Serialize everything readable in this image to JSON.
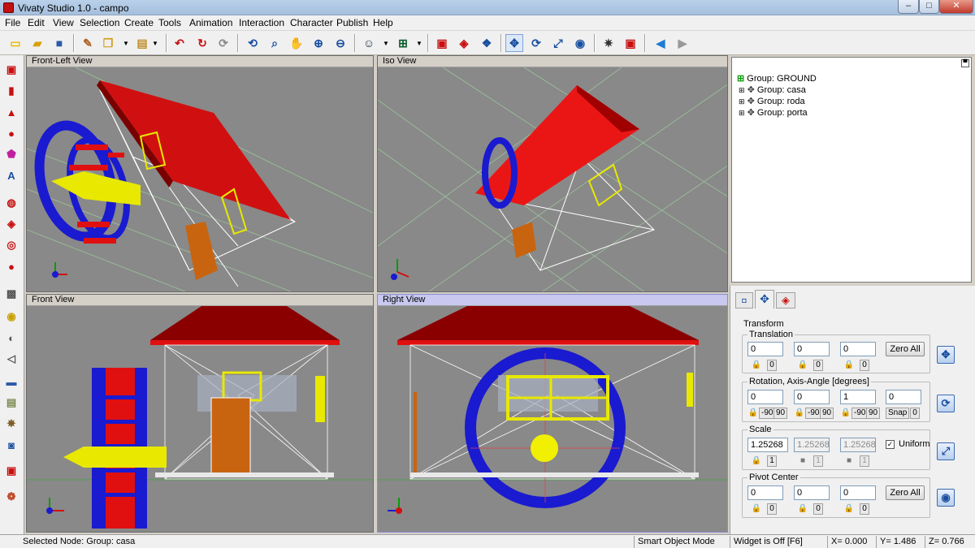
{
  "window": {
    "title": "Vivaty Studio 1.0 - campo",
    "min": "–",
    "max": "□",
    "close": "✕"
  },
  "menu": [
    "File",
    "Edit",
    "View",
    "Selection",
    "Create",
    "Tools",
    "Animation",
    "Interaction",
    "Character",
    "Publish",
    "Help"
  ],
  "toolbar_icons": [
    "new-icon",
    "open-icon",
    "save-icon",
    "paint-icon",
    "paste-icon",
    "clipboard-icon",
    "undo-icon",
    "redo-icon",
    "repeat-icon",
    "orbit-icon",
    "zoom-icon",
    "pan-hand-icon",
    "zoom-in-icon",
    "zoom-out-icon",
    "avatar-icon",
    "layout-icon",
    "box-icon",
    "material-icon",
    "cubes-icon",
    "move-icon",
    "rotate-icon",
    "scale-icon",
    "center-icon",
    "light-icon",
    "texture-icon",
    "back-arrow-icon",
    "forward-arrow-icon"
  ],
  "viewports": {
    "front_left": "Front-Left View",
    "iso": "Iso View",
    "front": "Front View",
    "right": "Right View"
  },
  "tree": {
    "root": "Group:  GROUND",
    "children": [
      "Group:  casa",
      "Group:  roda",
      "Group:  porta"
    ]
  },
  "props": {
    "tabs": [
      "node-tab",
      "transform-tab",
      "material-tab"
    ],
    "section": "Transform",
    "translation": {
      "label": "Translation",
      "values": [
        "0",
        "0",
        "0"
      ],
      "snap": [
        "0",
        "0",
        "0"
      ],
      "zero": "Zero All"
    },
    "rotation": {
      "label": "Rotation, Axis-Angle  [degrees]",
      "values": [
        "0",
        "0",
        "1",
        "0"
      ],
      "snap": [
        "-90",
        "90"
      ],
      "snap_label": "Snap",
      "snap_value": "0"
    },
    "scale": {
      "label": "Scale",
      "values": [
        "1.25268",
        "1.25268",
        "1.25268"
      ],
      "snap": [
        "1",
        "1",
        "1"
      ],
      "uniform": "Uniform"
    },
    "pivot": {
      "label": "Pivot Center",
      "values": [
        "0",
        "0",
        "0"
      ],
      "snap": [
        "0",
        "0",
        "0"
      ],
      "zero": "Zero All"
    }
  },
  "status": {
    "selected": "Selected Node: Group:  casa",
    "mode": "Smart Object Mode",
    "widget": "Widget is Off  [F6]",
    "x": "X=  0.000",
    "y": "Y=  1.486",
    "z": "Z=  0.766"
  }
}
